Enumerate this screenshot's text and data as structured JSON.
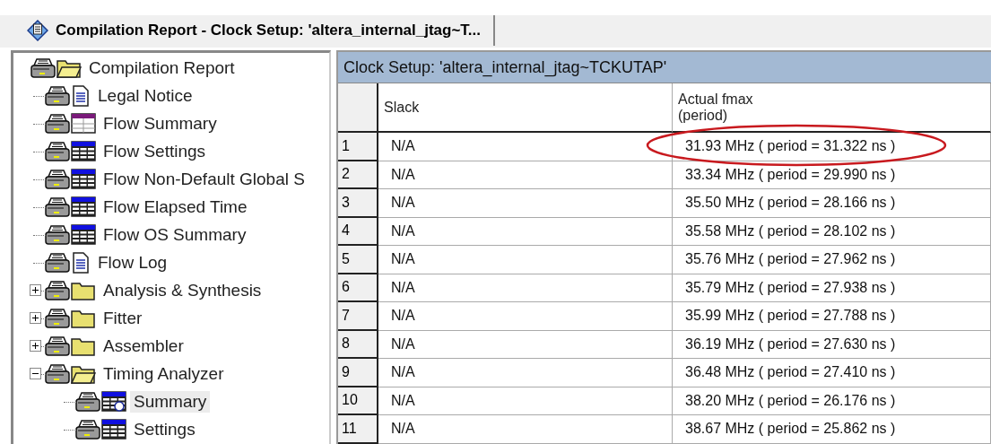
{
  "tab": {
    "title": "Compilation Report - Clock Setup: 'altera_internal_jtag~T..."
  },
  "tree": [
    {
      "label": "Compilation Report",
      "kind": "folder-open",
      "selected": false,
      "children": [
        {
          "label": "Legal Notice",
          "kind": "doc",
          "selected": false
        },
        {
          "label": "Flow Summary",
          "kind": "summary",
          "selected": false
        },
        {
          "label": "Flow Settings",
          "kind": "table",
          "selected": false
        },
        {
          "label": "Flow Non-Default Global S",
          "kind": "table",
          "selected": false
        },
        {
          "label": "Flow Elapsed Time",
          "kind": "table",
          "selected": false
        },
        {
          "label": "Flow OS Summary",
          "kind": "table",
          "selected": false
        },
        {
          "label": "Flow Log",
          "kind": "doc",
          "selected": false
        },
        {
          "label": "Analysis & Synthesis",
          "kind": "folder",
          "selected": false,
          "expanded": false
        },
        {
          "label": "Fitter",
          "kind": "folder",
          "selected": false,
          "expanded": false
        },
        {
          "label": "Assembler",
          "kind": "folder",
          "selected": false,
          "expanded": false
        },
        {
          "label": "Timing Analyzer",
          "kind": "folder-open",
          "selected": false,
          "expanded": true,
          "children": [
            {
              "label": "Summary",
              "kind": "timing",
              "selected": true
            },
            {
              "label": "Settings",
              "kind": "table",
              "selected": false
            }
          ]
        }
      ]
    }
  ],
  "report": {
    "title": "Clock Setup: 'altera_internal_jtag~TCKUTAP'",
    "columns": [
      "Slack",
      "Actual fmax\n(period)"
    ],
    "rows": [
      {
        "number": "1",
        "slack": "N/A",
        "fmax": "31.93 MHz ( period = 31.322 ns )",
        "circled": true
      },
      {
        "number": "2",
        "slack": "N/A",
        "fmax": "33.34 MHz ( period = 29.990 ns )",
        "circled": false
      },
      {
        "number": "3",
        "slack": "N/A",
        "fmax": "35.50 MHz ( period = 28.166 ns )",
        "circled": false
      },
      {
        "number": "4",
        "slack": "N/A",
        "fmax": "35.58 MHz ( period = 28.102 ns )",
        "circled": false
      },
      {
        "number": "5",
        "slack": "N/A",
        "fmax": "35.76 MHz ( period = 27.962 ns )",
        "circled": false
      },
      {
        "number": "6",
        "slack": "N/A",
        "fmax": "35.79 MHz ( period = 27.938 ns )",
        "circled": false
      },
      {
        "number": "7",
        "slack": "N/A",
        "fmax": "35.99 MHz ( period = 27.788 ns )",
        "circled": false
      },
      {
        "number": "8",
        "slack": "N/A",
        "fmax": "36.19 MHz ( period = 27.630 ns )",
        "circled": false
      },
      {
        "number": "9",
        "slack": "N/A",
        "fmax": "36.48 MHz ( period = 27.410 ns )",
        "circled": false
      },
      {
        "number": "10",
        "slack": "N/A",
        "fmax": "38.20 MHz ( period = 26.176 ns )",
        "circled": false
      },
      {
        "number": "11",
        "slack": "N/A",
        "fmax": "38.67 MHz ( period = 25.862 ns )",
        "circled": false
      }
    ]
  }
}
